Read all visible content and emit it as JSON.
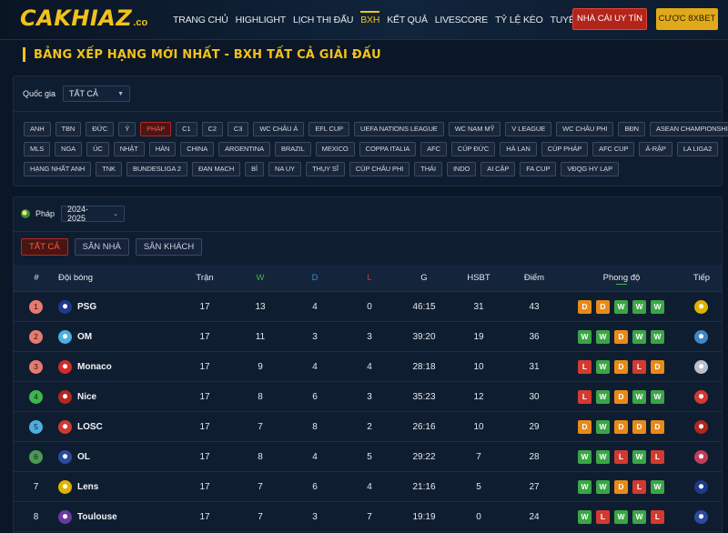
{
  "header": {
    "logo_main": "CAKHIAZ",
    "logo_suffix": ".co",
    "nav": [
      "TRANG CHỦ",
      "HIGHLIGHT",
      "LỊCH THI ĐẤU",
      "BXH",
      "KẾT QUẢ",
      "LIVESCORE",
      "TỶ LỆ KÈO",
      "TUYỂN DỤNG"
    ],
    "active_nav": 3,
    "btn_trusted": "NHÀ CÁI UY TÍN",
    "btn_bet": "CƯỢC 8XBET"
  },
  "page_title": "BẢNG XẾP HẠNG MỚI NHẤT - BXH TẤT CẢ GIẢI ĐẤU",
  "filters": {
    "country_label": "Quốc gia",
    "country_value": "TẤT CẢ",
    "leagues": [
      [
        "ANH",
        "TBN",
        "ĐỨC",
        "Ý",
        "PHÁP",
        "C1",
        "C2",
        "C3",
        "WC CHÂU Á",
        "EFL CUP",
        "UEFA NATIONS LEAGUE",
        "WC NAM MỸ",
        "V LEAGUE",
        "WC CHÂU PHI",
        "BĐN",
        "ASEAN CHAMPIONSHIP"
      ],
      [
        "MLS",
        "NGA",
        "ÚC",
        "NHẬT",
        "HÀN",
        "CHINA",
        "ARGENTINA",
        "BRAZIL",
        "MEXICO",
        "COPPA ITALIA",
        "AFC",
        "CÚP ĐỨC",
        "HÀ LAN",
        "CÚP PHÁP",
        "AFC CUP",
        "Ả-RẬP",
        "LA LIGA2"
      ],
      [
        "HẠNG NHẤT ANH",
        "TNK",
        "BUNDESLIGA 2",
        "ĐAN MẠCH",
        "BỈ",
        "NA UY",
        "THỤY SĨ",
        "CÚP CHÂU PHI",
        "THÁI",
        "INDO",
        "AI CẬP",
        "FA CUP",
        "VĐQG HY LẠP"
      ]
    ],
    "active_league": "PHÁP"
  },
  "standings": {
    "league": "Pháp",
    "season": "2024-2025",
    "tabs": [
      "TẤT CẢ",
      "SÂN NHÀ",
      "SÂN KHÁCH"
    ],
    "active_tab": 0,
    "columns": {
      "rank": "#",
      "team": "Đội bóng",
      "played": "Trận",
      "won": "W",
      "drawn": "D",
      "lost": "L",
      "goals": "G",
      "gd": "HSBT",
      "points": "Điểm",
      "form": "Phong độ",
      "next": "Tiếp"
    },
    "rows": [
      {
        "rank": "1",
        "team": "PSG",
        "played": "17",
        "won": "13",
        "drawn": "4",
        "lost": "0",
        "goals": "46:15",
        "gd": "31",
        "points": "43",
        "form": [
          "D",
          "D",
          "W",
          "W",
          "W"
        ],
        "rank_color": "#e87a6e",
        "logo_color": "#1e3a8a",
        "next_color": "#e0b300"
      },
      {
        "rank": "2",
        "team": "OM",
        "played": "17",
        "won": "11",
        "drawn": "3",
        "lost": "3",
        "goals": "39:20",
        "gd": "19",
        "points": "36",
        "form": [
          "W",
          "W",
          "D",
          "W",
          "W"
        ],
        "rank_color": "#e87a6e",
        "logo_color": "#4ab0e0",
        "next_color": "#3f86c9"
      },
      {
        "rank": "3",
        "team": "Monaco",
        "played": "17",
        "won": "9",
        "drawn": "4",
        "lost": "4",
        "goals": "28:18",
        "gd": "10",
        "points": "31",
        "form": [
          "L",
          "W",
          "D",
          "L",
          "D"
        ],
        "rank_color": "#e87a6e",
        "logo_color": "#d42a2a",
        "next_color": "#b9c0c8"
      },
      {
        "rank": "4",
        "team": "Nice",
        "played": "17",
        "won": "8",
        "drawn": "6",
        "lost": "3",
        "goals": "35:23",
        "gd": "12",
        "points": "30",
        "form": [
          "L",
          "W",
          "D",
          "W",
          "W"
        ],
        "rank_color": "#3fb54a",
        "logo_color": "#b3261e",
        "next_color": "#d23a2f"
      },
      {
        "rank": "5",
        "team": "LOSC",
        "played": "17",
        "won": "7",
        "drawn": "8",
        "lost": "2",
        "goals": "26:16",
        "gd": "10",
        "points": "29",
        "form": [
          "D",
          "W",
          "D",
          "D",
          "D"
        ],
        "rank_color": "#4ab0e0",
        "logo_color": "#d23a2f",
        "next_color": "#b3261e"
      },
      {
        "rank": "6",
        "team": "OL",
        "played": "17",
        "won": "8",
        "drawn": "4",
        "lost": "5",
        "goals": "29:22",
        "gd": "7",
        "points": "28",
        "form": [
          "W",
          "W",
          "L",
          "W",
          "L"
        ],
        "rank_color": "#4a9a55",
        "logo_color": "#2b4b9c",
        "next_color": "#c23c5a"
      },
      {
        "rank": "7",
        "team": "Lens",
        "played": "17",
        "won": "7",
        "drawn": "6",
        "lost": "4",
        "goals": "21:16",
        "gd": "5",
        "points": "27",
        "form": [
          "W",
          "W",
          "D",
          "L",
          "W"
        ],
        "rank_color": "",
        "logo_color": "#e0b300",
        "next_color": "#1e3a8a"
      },
      {
        "rank": "8",
        "team": "Toulouse",
        "played": "17",
        "won": "7",
        "drawn": "3",
        "lost": "7",
        "goals": "19:19",
        "gd": "0",
        "points": "24",
        "form": [
          "W",
          "L",
          "W",
          "W",
          "L"
        ],
        "rank_color": "",
        "logo_color": "#6a3aa0",
        "next_color": "#2b4b9c"
      }
    ]
  }
}
